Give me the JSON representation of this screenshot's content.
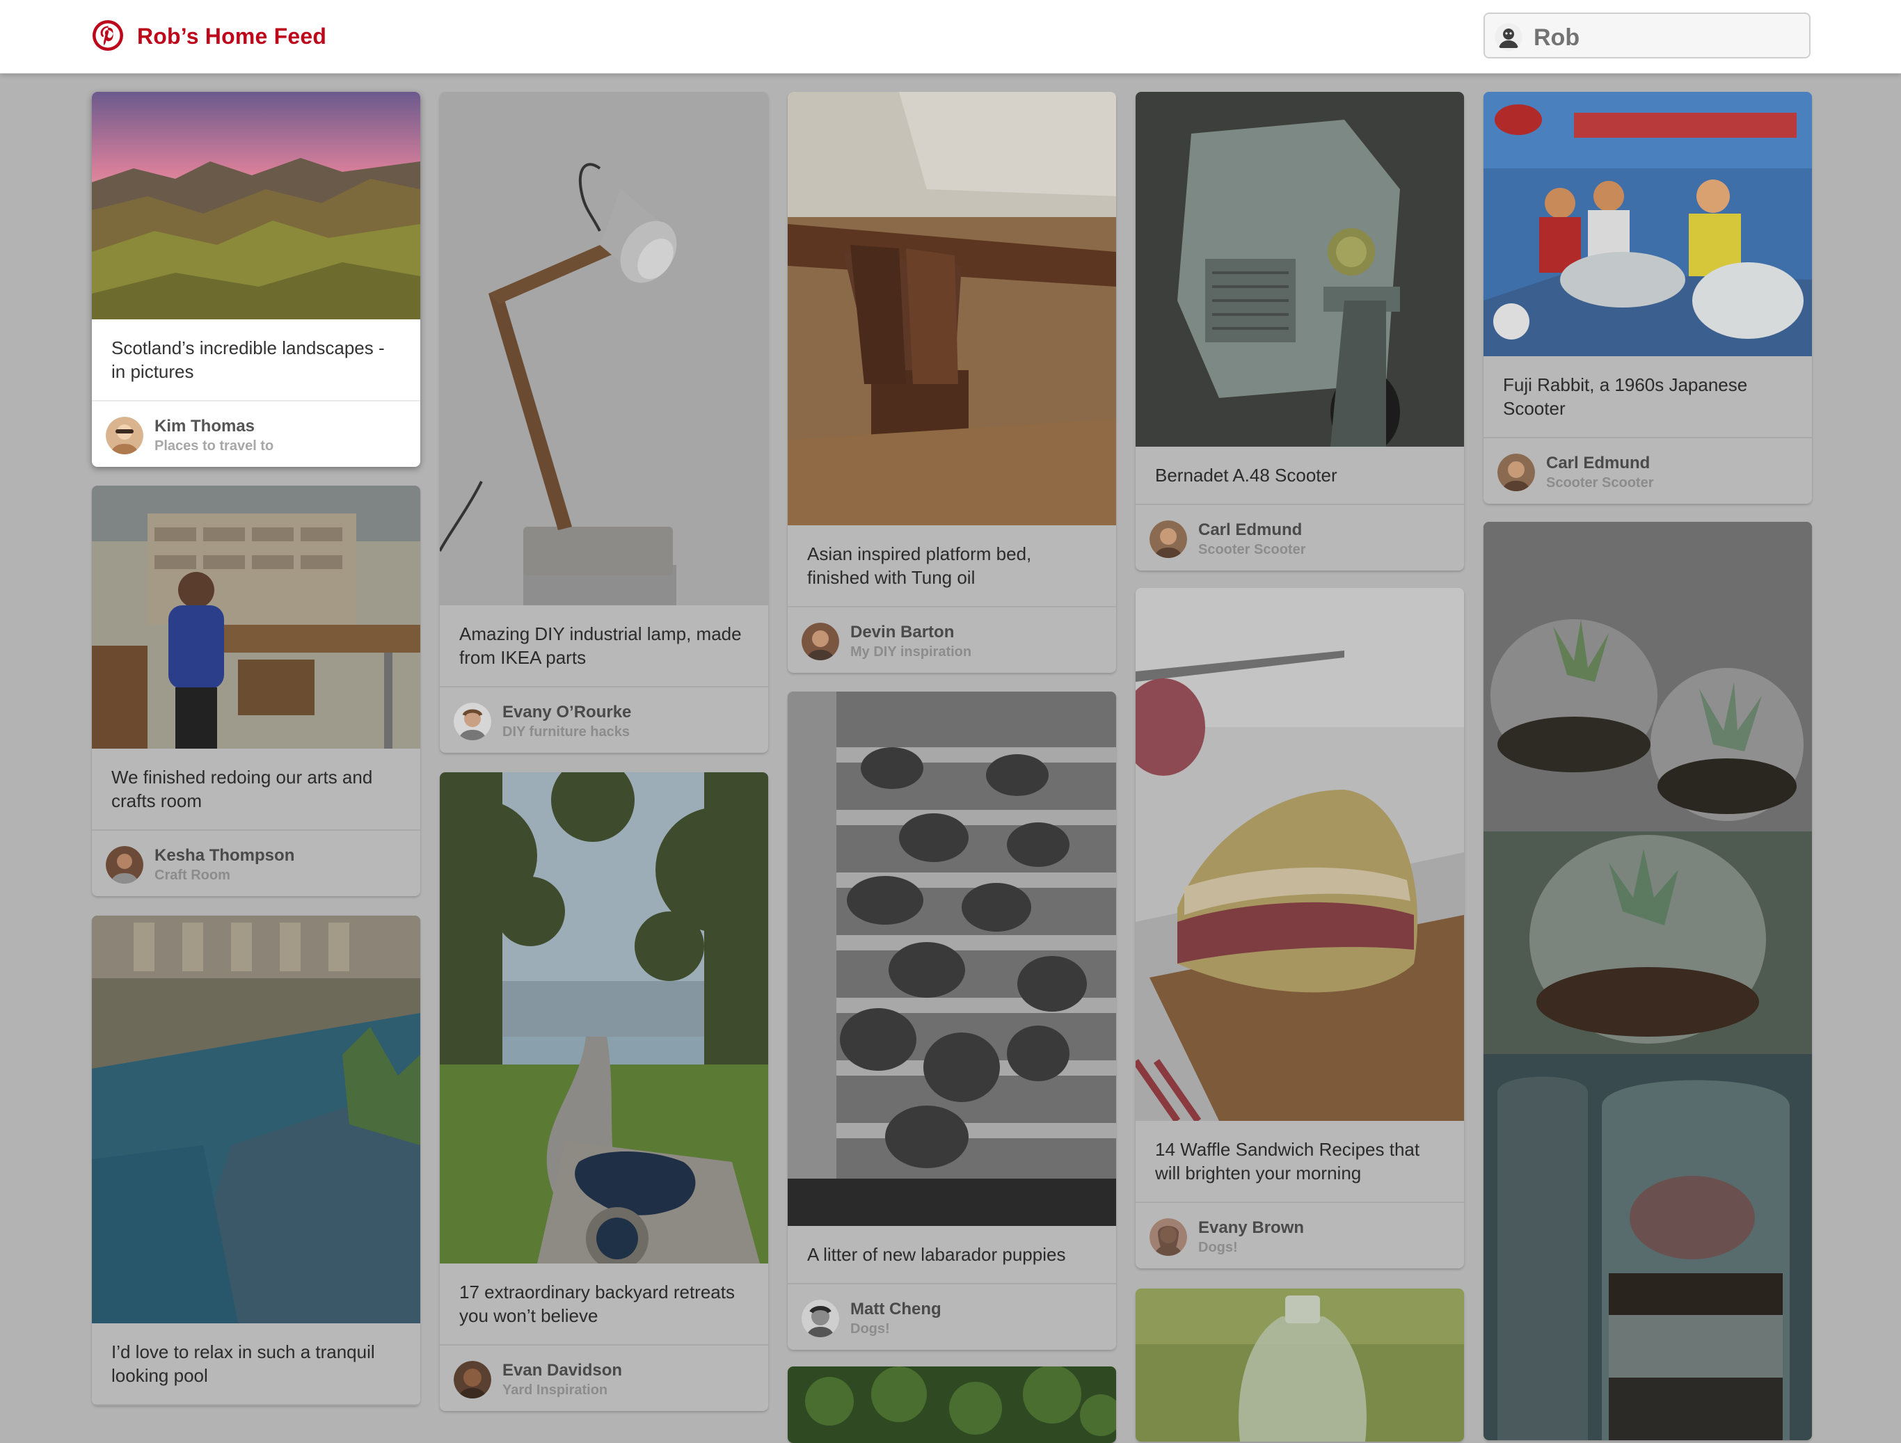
{
  "header": {
    "title": "Rob’s Home Feed",
    "logo_icon": "pinterest-logo-icon",
    "brand_color": "#bd081c",
    "user": {
      "name": "Rob",
      "avatar_icon": "user-avatar-icon"
    }
  },
  "pins": [
    {
      "id": "scotland",
      "description": "Scotland’s incredible landscapes - in pictures",
      "pinner": "Kim Thomas",
      "board": "Places to travel to",
      "highlighted": true
    },
    {
      "id": "craft-room",
      "description": "We finished redoing our arts and crafts room",
      "pinner": "Kesha Thompson",
      "board": "Craft Room"
    },
    {
      "id": "pool",
      "description": "I’d love to relax in such a tranquil looking pool",
      "pinner": "",
      "board": ""
    },
    {
      "id": "lamp",
      "description": "Amazing DIY industrial lamp, made from IKEA parts",
      "pinner": "Evany O’Rourke",
      "board": "DIY furniture hacks"
    },
    {
      "id": "backyard",
      "description": "17 extraordinary backyard retreats you won’t believe",
      "pinner": "Evan Davidson",
      "board": "Yard Inspiration"
    },
    {
      "id": "bed",
      "description": "Asian inspired platform bed, finished with Tung oil",
      "pinner": "Devin Barton",
      "board": "My DIY inspiration"
    },
    {
      "id": "puppies",
      "description": "A litter of new labarador puppies",
      "pinner": "Matt Cheng",
      "board": "Dogs!"
    },
    {
      "id": "plants",
      "description": "",
      "pinner": "",
      "board": ""
    },
    {
      "id": "bernadet",
      "description": "Bernadet A.48 Scooter",
      "pinner": "Carl Edmund",
      "board": "Scooter Scooter"
    },
    {
      "id": "waffle",
      "description": "14 Waffle Sandwich Recipes that will brighten your morning",
      "pinner": "Evany Brown",
      "board": "Dogs!"
    },
    {
      "id": "bottle",
      "description": "",
      "pinner": "",
      "board": ""
    },
    {
      "id": "fuji",
      "description": "Fuji Rabbit, a 1960s Japanese Scooter",
      "pinner": "Carl Edmund",
      "board": "Scooter Scooter"
    },
    {
      "id": "terrarium",
      "description": "",
      "pinner": "",
      "board": ""
    }
  ]
}
